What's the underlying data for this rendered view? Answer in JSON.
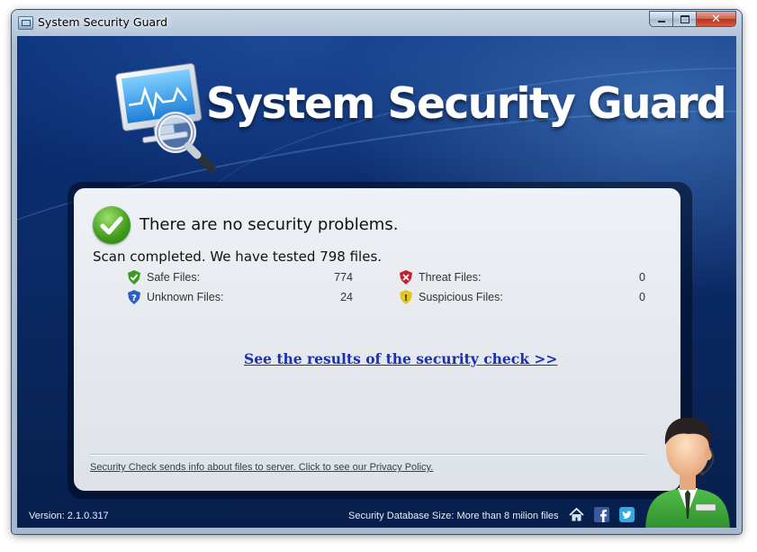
{
  "window": {
    "title": "System Security Guard",
    "buttons": {
      "minimize": "minimize",
      "maximize": "maximize",
      "close": "close"
    }
  },
  "header": {
    "logo_text": "System Security Guard",
    "logo_icon": "monitor-magnifier-icon"
  },
  "panel": {
    "status": "There are no security problems.",
    "summary": "Scan completed. We have tested 798 files.",
    "stats": [
      {
        "label": "Safe Files:",
        "value": "774",
        "icon": "green-shield-check-icon"
      },
      {
        "label": "Unknown Files:",
        "value": "24",
        "icon": "blue-shield-question-icon"
      },
      {
        "label": "Threat Files:",
        "value": "0",
        "icon": "red-shield-x-icon"
      },
      {
        "label": "Suspicious Files:",
        "value": "0",
        "icon": "yellow-shield-exclamation-icon"
      }
    ],
    "results_link": "See the results of the security check >>",
    "privacy_text": "Security Check sends info about files to server. Click to see our Privacy Policy."
  },
  "footer": {
    "version": "Version:  2.1.0.317",
    "db_size": "Security Database Size: More than 8 milion files",
    "icons": [
      "home-icon",
      "facebook-icon",
      "twitter-icon"
    ]
  },
  "colors": {
    "background": "#0b2a66",
    "link": "#1a2fb4",
    "panel": "#e4e8ed",
    "success": "#3f9a1c"
  }
}
